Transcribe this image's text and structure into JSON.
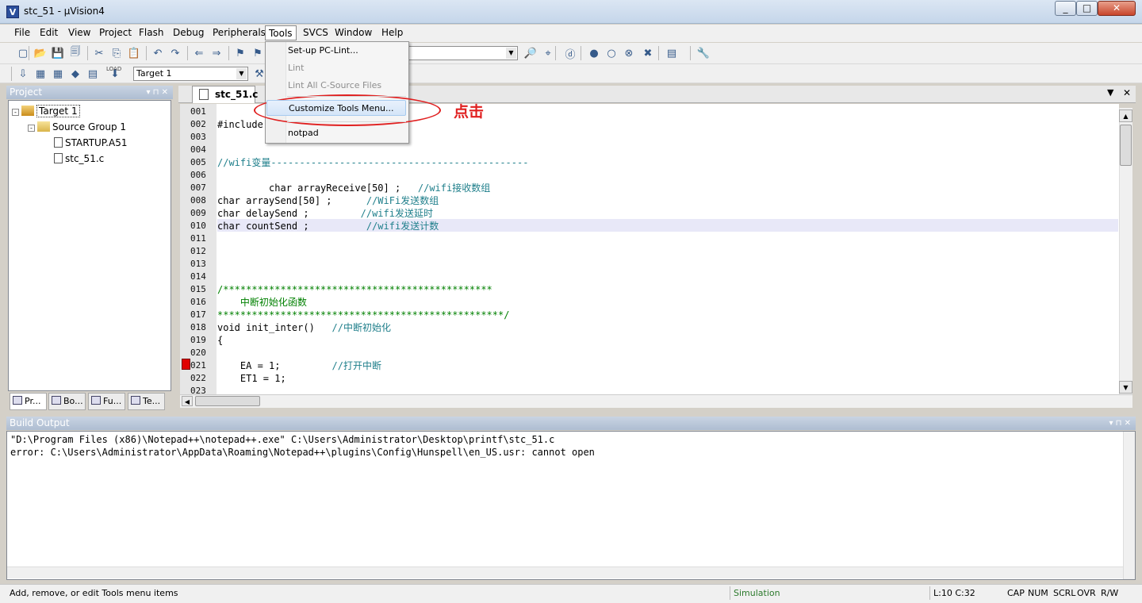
{
  "window": {
    "title": "stc_51  - µVision4",
    "app_icon": "uv-logo-icon"
  },
  "menubar": [
    {
      "key": "file",
      "label": "File",
      "ul": "F",
      "rest": "ile"
    },
    {
      "key": "edit",
      "label": "Edit",
      "ul": "E",
      "rest": "dit"
    },
    {
      "key": "view",
      "label": "View",
      "ul": "V",
      "rest": "iew"
    },
    {
      "key": "project",
      "label": "Project",
      "ul": "P",
      "rest": "roject"
    },
    {
      "key": "flash",
      "label": "Flash",
      "pre": "Fl",
      "ul": "a",
      "rest": "sh"
    },
    {
      "key": "debug",
      "label": "Debug",
      "ul": "D",
      "rest": "ebug"
    },
    {
      "key": "peripherals",
      "label": "Peripherals",
      "pre": "Periph",
      "ul": "e",
      "rest": "rals"
    },
    {
      "key": "tools",
      "label": "Tools",
      "ul": "T",
      "rest": "ools"
    },
    {
      "key": "svcs",
      "label": "SVCS",
      "ul": "S",
      "rest": "VCS"
    },
    {
      "key": "window",
      "label": "Window",
      "ul": "W",
      "rest": "indow"
    },
    {
      "key": "help",
      "label": "Help",
      "ul": "H",
      "rest": "elp"
    }
  ],
  "toolbar": {
    "target": "Target 1",
    "load_label": "LOAD"
  },
  "tools_menu": {
    "items": [
      {
        "label": "Set-up PC-Lint...",
        "enabled": true
      },
      {
        "label": "Lint",
        "enabled": false
      },
      {
        "label": "Lint All C-Source Files",
        "enabled": false
      },
      {
        "label": "Customize Tools Menu...",
        "enabled": true,
        "highlighted": true
      },
      {
        "label": "notpad",
        "enabled": true
      }
    ]
  },
  "annotation": {
    "text": "点击",
    "color": "#e02020"
  },
  "project": {
    "title": "Project",
    "tree": [
      {
        "label": "Target 1",
        "level": 0,
        "icon": "target-icon",
        "expand": "-"
      },
      {
        "label": "Source Group 1",
        "level": 1,
        "icon": "folder-icon",
        "expand": "-"
      },
      {
        "label": "STARTUP.A51",
        "level": 2,
        "icon": "file-icon"
      },
      {
        "label": "stc_51.c",
        "level": 2,
        "icon": "file-icon"
      }
    ],
    "tabs": [
      "Pr...",
      "Bo...",
      "Fu...",
      "Te..."
    ]
  },
  "editor": {
    "tab": "stc_51.c",
    "highlight_line": 10,
    "breakpoint_line": 21,
    "line_numbers": [
      "001",
      "002",
      "003",
      "004",
      "005",
      "006",
      "007",
      "008",
      "009",
      "010",
      "011",
      "012",
      "013",
      "014",
      "015",
      "016",
      "017",
      "018",
      "019",
      "020",
      "021",
      "022",
      "023"
    ],
    "lines": [
      "",
      "#include",
      "",
      "",
      "//wifi变量---------------------------------------------",
      "",
      "         char arrayReceive[50] ;   //wifi接收数组",
      "char arraySend[50] ;      //WiFi发送数组",
      "char delaySend ;         //wifi发送延时",
      "char countSend ;          //wifi发送计数",
      "",
      "",
      "",
      "",
      "/***********************************************",
      "    中断初始化函数",
      "**************************************************/",
      "void init_inter()   //中断初始化",
      "{",
      "",
      "    EA = 1;         //打开中断",
      "    ET1 = 1;",
      ""
    ]
  },
  "build_output": {
    "title": "Build Output",
    "lines": [
      "\"D:\\Program Files (x86)\\Notepad++\\notepad++.exe\" C:\\Users\\Administrator\\Desktop\\printf\\stc_51.c",
      "error: C:\\Users\\Administrator\\AppData\\Roaming\\Notepad++\\plugins\\Config\\Hunspell\\en_US.usr: cannot open"
    ]
  },
  "status": {
    "message": "Add, remove, or edit Tools menu items",
    "mode": "Simulation",
    "position": "L:10 C:32",
    "cap": "CAP",
    "num": "NUM",
    "scrl": "SCRL",
    "ovr": "OVR",
    "rw": "R/W"
  }
}
